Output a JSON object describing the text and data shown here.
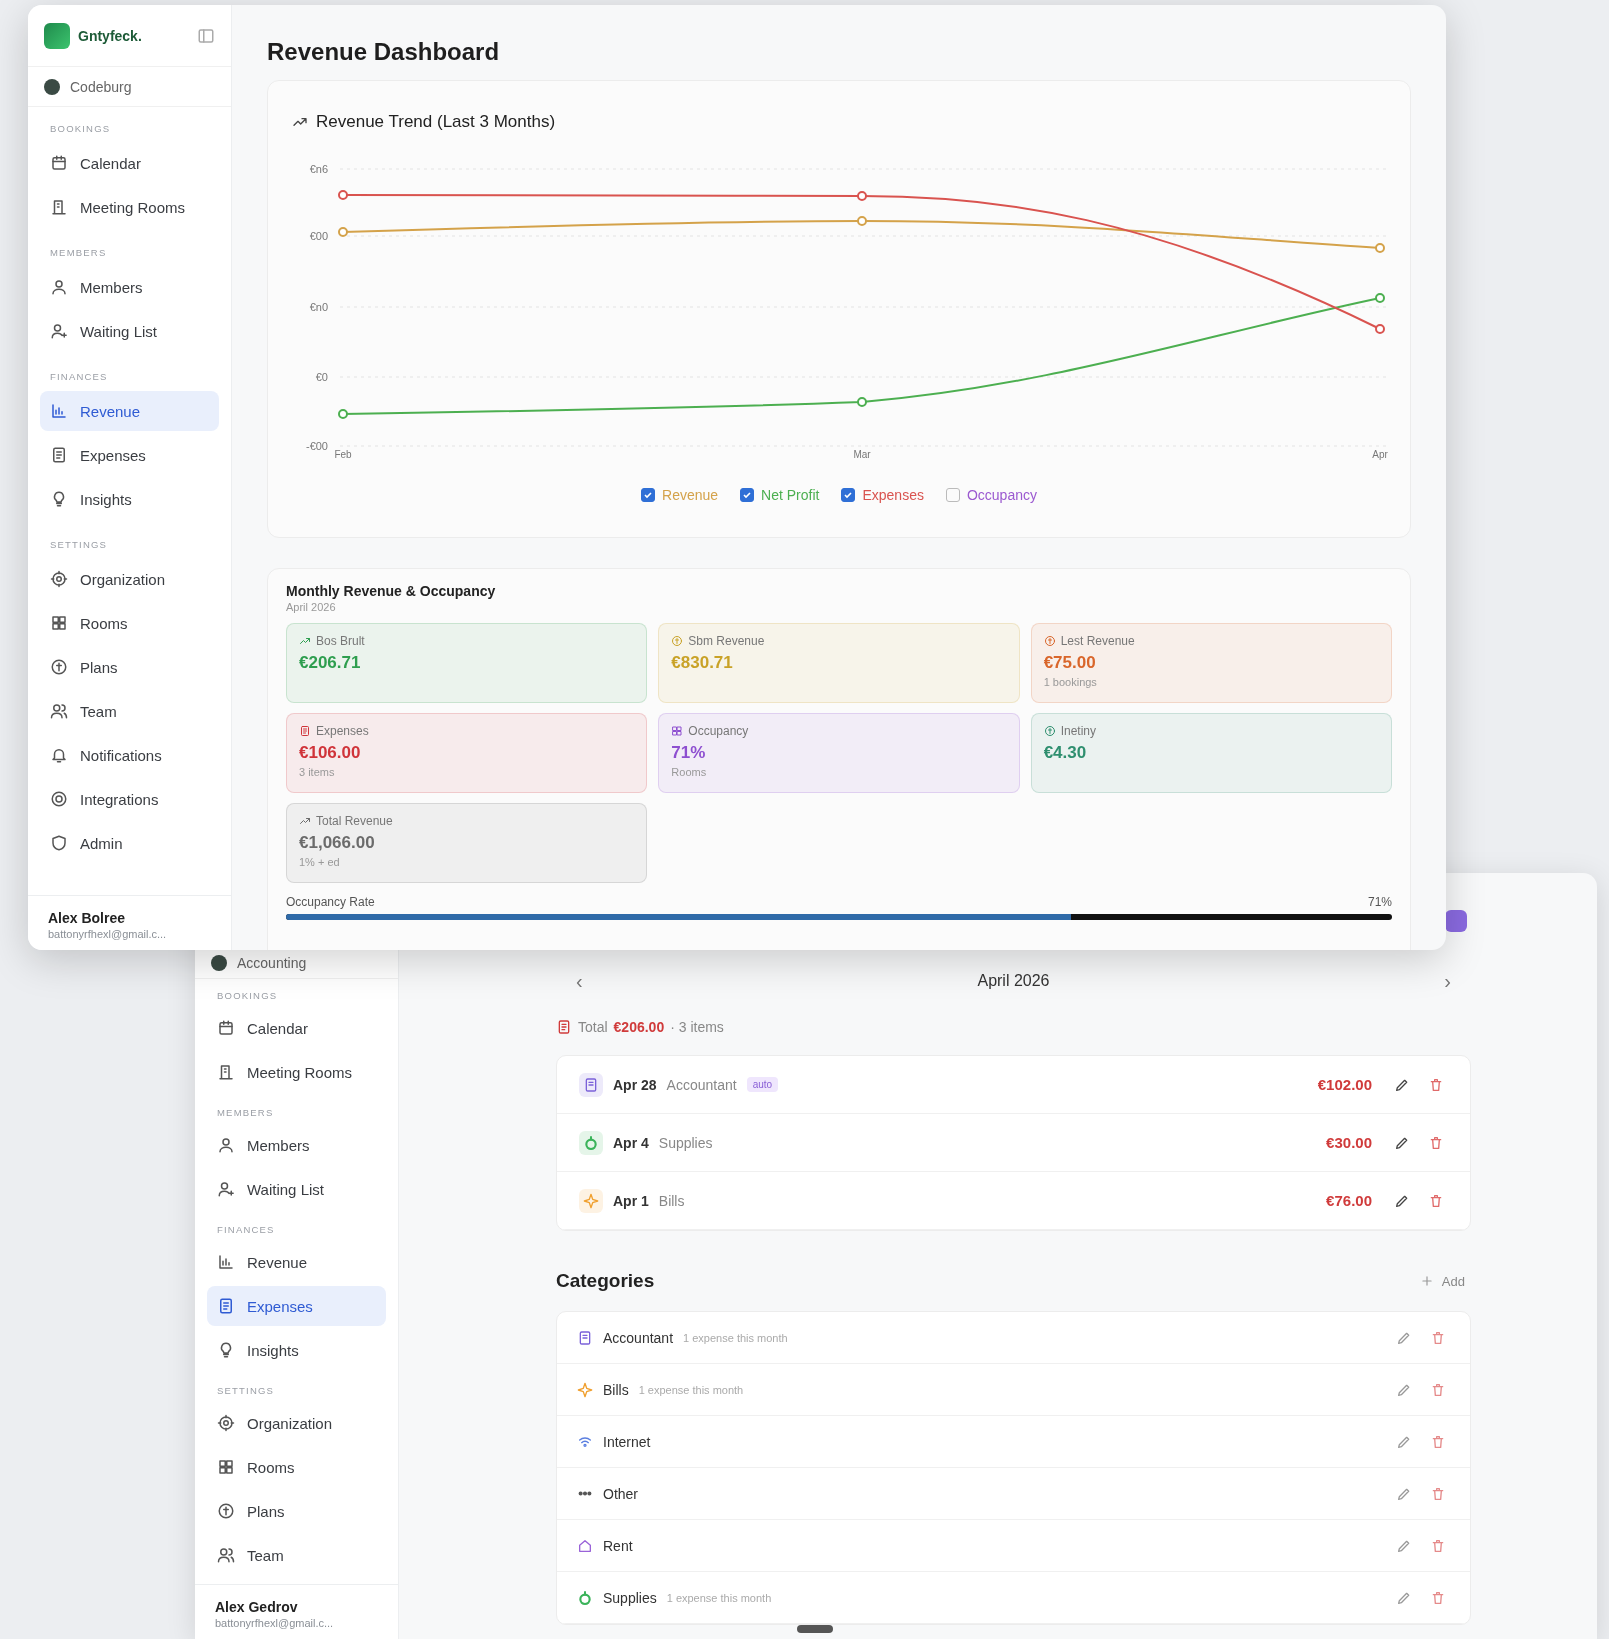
{
  "dashboard_window": {
    "sidebar": {
      "logo": "Gntyfeck.",
      "workspace": "Codeburg",
      "sections": [
        {
          "heading": "BOOKINGS",
          "items": [
            {
              "label": "Calendar",
              "selected": false
            },
            {
              "label": "Meeting Rooms",
              "selected": false
            }
          ]
        },
        {
          "heading": "MEMBERS",
          "items": [
            {
              "label": "Members",
              "selected": false
            },
            {
              "label": "Waiting List",
              "selected": false
            }
          ]
        },
        {
          "heading": "FINANCES",
          "items": [
            {
              "label": "Revenue",
              "selected": true
            },
            {
              "label": "Expenses",
              "selected": false
            },
            {
              "label": "Insights",
              "selected": false
            }
          ]
        },
        {
          "heading": "SETTINGS",
          "items": [
            {
              "label": "Organization",
              "selected": false
            },
            {
              "label": "Rooms",
              "selected": false
            },
            {
              "label": "Plans",
              "selected": false
            },
            {
              "label": "Team",
              "selected": false
            },
            {
              "label": "Notifications",
              "selected": false
            },
            {
              "label": "Integrations",
              "selected": false
            },
            {
              "label": "Admin",
              "selected": false
            }
          ]
        }
      ],
      "user": {
        "name": "Alex Bolree",
        "email": "battonyrfhexl@gmail.c..."
      }
    },
    "title": "Revenue Dashboard",
    "trend_card": {
      "title": "Revenue Trend (Last 3 Months)",
      "y_labels": [
        "€n6",
        "€00",
        "€n0",
        "€0",
        "-€00"
      ],
      "x_labels": [
        "Feb",
        "Mar",
        "Apr"
      ],
      "legend": [
        {
          "label": "Revenue",
          "checked": true,
          "color": "#d4a24a"
        },
        {
          "label": "Net Profit",
          "checked": true,
          "color": "#4caf50"
        },
        {
          "label": "Expenses",
          "checked": true,
          "color": "#d9534f"
        },
        {
          "label": "Occupancy",
          "checked": false,
          "color": "#9b59d0"
        }
      ]
    },
    "monthly_card": {
      "title": "Monthly Revenue & Occupancy",
      "subtitle": "April 2026",
      "stats": [
        {
          "label": "Bos Brult",
          "value": "€206.71",
          "color": "#2e9e4f"
        },
        {
          "label": "Sbm Revenue",
          "value": "€830.71",
          "color": "#c9a227"
        },
        {
          "label": "Lest Revenue",
          "value": "€75.00",
          "note": "1 bookings",
          "color": "#d9662b"
        },
        {
          "label": "Expenses",
          "value": "€106.00",
          "note": "3 items",
          "color": "#d0343a"
        },
        {
          "label": "Occupancy",
          "value": "71%",
          "note": "Rooms",
          "color": "#8e4fd0"
        },
        {
          "label": "Inetiny",
          "value": "€4.30",
          "color": "#2f8f6f"
        },
        {
          "label": "Total Revenue",
          "value": "€1,066.00",
          "note": "1% + ed",
          "color": "#6b6b6b"
        }
      ],
      "occupancy": {
        "label": "Occupancy Rate",
        "reading": "71%",
        "level": 0.71
      }
    }
  },
  "expenses_window": {
    "sidebar": {
      "workspace": "Accounting",
      "sections": [
        {
          "heading": "BOOKINGS",
          "items": [
            {
              "label": "Calendar",
              "selected": false
            },
            {
              "label": "Meeting Rooms",
              "selected": false
            }
          ]
        },
        {
          "heading": "MEMBERS",
          "items": [
            {
              "label": "Members",
              "selected": false
            },
            {
              "label": "Waiting List",
              "selected": false
            }
          ]
        },
        {
          "heading": "FINANCES",
          "items": [
            {
              "label": "Revenue",
              "selected": false
            },
            {
              "label": "Expenses",
              "selected": true
            },
            {
              "label": "Insights",
              "selected": false
            }
          ]
        },
        {
          "heading": "SETTINGS",
          "items": [
            {
              "label": "Organization",
              "selected": false
            },
            {
              "label": "Rooms",
              "selected": false
            },
            {
              "label": "Plans",
              "selected": false
            },
            {
              "label": "Team",
              "selected": false
            }
          ]
        }
      ],
      "user": {
        "name": "Alex Gedrov",
        "email": "battonyrfhexl@gmail.c..."
      }
    },
    "month": {
      "prev": "‹",
      "title": "April 2026",
      "next": "›"
    },
    "total": {
      "label": "Total",
      "amount": "€206.00",
      "count": "· 3 items"
    },
    "expenses": [
      {
        "date": "Apr 28",
        "category": "Accountant",
        "tag": "auto",
        "amount": "€102.00",
        "color": "#7b61d9"
      },
      {
        "date": "Apr 4",
        "category": "Supplies",
        "amount": "€30.00",
        "color": "#3bb35a"
      },
      {
        "date": "Apr 1",
        "category": "Bills",
        "amount": "€76.00",
        "color": "#f0a030"
      }
    ],
    "categories": {
      "title": "Categories",
      "add": "Add",
      "items": [
        {
          "name": "Accountant",
          "note": "1 expense this month",
          "color": "#7b61d9"
        },
        {
          "name": "Bills",
          "note": "1 expense this month",
          "color": "#f0a030"
        },
        {
          "name": "Internet",
          "color": "#5b7fe0"
        },
        {
          "name": "Other",
          "color": "#555555"
        },
        {
          "name": "Rent",
          "color": "#9a63d8"
        },
        {
          "name": "Supplies",
          "note": "1 expense this month",
          "color": "#3bb35a"
        }
      ]
    }
  }
}
